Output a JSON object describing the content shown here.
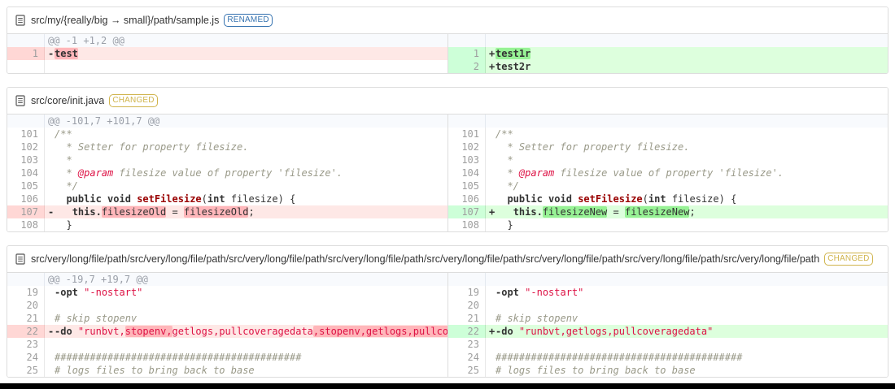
{
  "colors": {
    "panel_border": "#dddddd",
    "del_line_bg": "#fee8e6",
    "del_gutter_bg": "#ffd7d5",
    "del_word_highlight": "#ffb6ba",
    "ins_line_bg": "#ddffdd",
    "ins_gutter_bg": "#cdffd8",
    "ins_word_highlight": "#97f295",
    "hunk_header_bg": "#f8fafd",
    "renamed_tag": "#3572b0",
    "changed_tag": "#d0b44c",
    "string_token": "#d14",
    "comment_token": "#998",
    "function_token": "#900",
    "bottom_bar": "#000000"
  },
  "files": [
    {
      "name": "src/my/{really/big → small}/path/sample.js",
      "tag": "RENAMED",
      "tag_color": "#3572b0",
      "hunk_header": "@@ -1 +1,2 @@",
      "left": [
        {
          "type": "info",
          "text": "@@ -1 +1,2 @@"
        },
        {
          "type": "del",
          "num": "1",
          "prefix": "-",
          "segments": [
            {
              "t": "test",
              "c": "kw",
              "hl": true
            }
          ]
        },
        {
          "type": "empty"
        }
      ],
      "right": [
        {
          "type": "info",
          "text": ""
        },
        {
          "type": "ins",
          "num": "1",
          "prefix": "+",
          "segments": [
            {
              "t": "test1r",
              "c": "kw",
              "hl": true
            }
          ]
        },
        {
          "type": "ins",
          "num": "2",
          "prefix": "+",
          "segments": [
            {
              "t": "test2r",
              "c": "kw"
            }
          ]
        }
      ]
    },
    {
      "name": "src/core/init.java",
      "tag": "CHANGED",
      "tag_color": "#d0b44c",
      "hunk_header": "@@ -101,7 +101,7 @@",
      "left": [
        {
          "type": "info",
          "text": "@@ -101,7 +101,7 @@"
        },
        {
          "type": "cntx",
          "num": "101",
          "prefix": "",
          "segments": [
            {
              "t": "/**",
              "c": "com"
            }
          ]
        },
        {
          "type": "cntx",
          "num": "102",
          "prefix": "",
          "segments": [
            {
              "t": "  * Setter for property filesize.",
              "c": "com"
            }
          ]
        },
        {
          "type": "cntx",
          "num": "103",
          "prefix": "",
          "segments": [
            {
              "t": "  *",
              "c": "com"
            }
          ]
        },
        {
          "type": "cntx",
          "num": "104",
          "prefix": "",
          "segments": [
            {
              "t": "  * ",
              "c": "com"
            },
            {
              "t": "@param",
              "c": "doc"
            },
            {
              "t": " filesize value of property 'filesize'.",
              "c": "com"
            }
          ]
        },
        {
          "type": "cntx",
          "num": "105",
          "prefix": "",
          "segments": [
            {
              "t": "  */",
              "c": "com"
            }
          ]
        },
        {
          "type": "cntx",
          "num": "106",
          "prefix": "",
          "segments": [
            {
              "t": "  "
            },
            {
              "t": "public",
              "c": "kw"
            },
            {
              "t": " "
            },
            {
              "t": "void",
              "c": "kw"
            },
            {
              "t": " "
            },
            {
              "t": "setFilesize",
              "c": "title"
            },
            {
              "t": "("
            },
            {
              "t": "int",
              "c": "kw"
            },
            {
              "t": " filesize) {"
            }
          ]
        },
        {
          "type": "del",
          "num": "107",
          "prefix": "-",
          "segments": [
            {
              "t": "   "
            },
            {
              "t": "this.",
              "c": "kw"
            },
            {
              "t": "filesizeOld",
              "hl": true
            },
            {
              "t": " = "
            },
            {
              "t": "filesizeOld",
              "hl": true
            },
            {
              "t": ";"
            }
          ]
        },
        {
          "type": "cntx",
          "num": "108",
          "prefix": "",
          "segments": [
            {
              "t": "  }"
            }
          ]
        }
      ],
      "right": [
        {
          "type": "info",
          "text": ""
        },
        {
          "type": "cntx",
          "num": "101",
          "prefix": "",
          "segments": [
            {
              "t": "/**",
              "c": "com"
            }
          ]
        },
        {
          "type": "cntx",
          "num": "102",
          "prefix": "",
          "segments": [
            {
              "t": "  * Setter for property filesize.",
              "c": "com"
            }
          ]
        },
        {
          "type": "cntx",
          "num": "103",
          "prefix": "",
          "segments": [
            {
              "t": "  *",
              "c": "com"
            }
          ]
        },
        {
          "type": "cntx",
          "num": "104",
          "prefix": "",
          "segments": [
            {
              "t": "  * ",
              "c": "com"
            },
            {
              "t": "@param",
              "c": "doc"
            },
            {
              "t": " filesize value of property 'filesize'.",
              "c": "com"
            }
          ]
        },
        {
          "type": "cntx",
          "num": "105",
          "prefix": "",
          "segments": [
            {
              "t": "  */",
              "c": "com"
            }
          ]
        },
        {
          "type": "cntx",
          "num": "106",
          "prefix": "",
          "segments": [
            {
              "t": "  "
            },
            {
              "t": "public",
              "c": "kw"
            },
            {
              "t": " "
            },
            {
              "t": "void",
              "c": "kw"
            },
            {
              "t": " "
            },
            {
              "t": "setFilesize",
              "c": "title"
            },
            {
              "t": "("
            },
            {
              "t": "int",
              "c": "kw"
            },
            {
              "t": " filesize) {"
            }
          ]
        },
        {
          "type": "ins",
          "num": "107",
          "prefix": "+",
          "segments": [
            {
              "t": "   "
            },
            {
              "t": "this.",
              "c": "kw"
            },
            {
              "t": "filesizeNew",
              "hl": true
            },
            {
              "t": " = "
            },
            {
              "t": "filesizeNew",
              "hl": true
            },
            {
              "t": ";"
            }
          ]
        },
        {
          "type": "cntx",
          "num": "108",
          "prefix": "",
          "segments": [
            {
              "t": "  }"
            }
          ]
        }
      ]
    },
    {
      "name": "src/very/long/file/path/src/very/long/file/path/src/very/long/file/path/src/very/long/file/path/src/very/long/file/path/src/very/long/file/path/src/very/long/file/path/src/very/long/file/path",
      "tag": "CHANGED",
      "tag_color": "#d0b44c",
      "hunk_header": "@@ -19,7 +19,7 @@",
      "left": [
        {
          "type": "info",
          "text": "@@ -19,7 +19,7 @@"
        },
        {
          "type": "cntx",
          "num": "19",
          "prefix": "",
          "segments": [
            {
              "t": "-opt",
              "c": "kw"
            },
            {
              "t": " "
            },
            {
              "t": "\"-nostart\"",
              "c": "str"
            }
          ]
        },
        {
          "type": "cntx",
          "num": "20",
          "prefix": "",
          "segments": []
        },
        {
          "type": "cntx",
          "num": "21",
          "prefix": "",
          "segments": [
            {
              "t": "# skip stopenv",
              "c": "com"
            }
          ]
        },
        {
          "type": "del",
          "num": "22",
          "prefix": "-",
          "segments": [
            {
              "t": "-do",
              "c": "kw"
            },
            {
              "t": " "
            },
            {
              "t": "\"runbvt,",
              "c": "str"
            },
            {
              "t": "stopenv,",
              "c": "str",
              "hl": true
            },
            {
              "t": "getlogs,pullcoveragedata",
              "c": "str"
            },
            {
              "t": ",stopenv,getlogs,pullcoveragedata",
              "c": "str",
              "hl": true
            },
            {
              "t": "\"",
              "c": "str"
            }
          ]
        },
        {
          "type": "cntx",
          "num": "23",
          "prefix": "",
          "segments": []
        },
        {
          "type": "cntx",
          "num": "24",
          "prefix": "",
          "segments": [
            {
              "t": "##########################################",
              "c": "com"
            }
          ]
        },
        {
          "type": "cntx",
          "num": "25",
          "prefix": "",
          "segments": [
            {
              "t": "# logs files to bring back to base",
              "c": "com"
            }
          ]
        }
      ],
      "right": [
        {
          "type": "info",
          "text": ""
        },
        {
          "type": "cntx",
          "num": "19",
          "prefix": "",
          "segments": [
            {
              "t": "-opt",
              "c": "kw"
            },
            {
              "t": " "
            },
            {
              "t": "\"-nostart\"",
              "c": "str"
            }
          ]
        },
        {
          "type": "cntx",
          "num": "20",
          "prefix": "",
          "segments": []
        },
        {
          "type": "cntx",
          "num": "21",
          "prefix": "",
          "segments": [
            {
              "t": "# skip stopenv",
              "c": "com"
            }
          ]
        },
        {
          "type": "ins",
          "num": "22",
          "prefix": "+",
          "segments": [
            {
              "t": "-do",
              "c": "kw"
            },
            {
              "t": " "
            },
            {
              "t": "\"runbvt,getlogs,pullcoveragedata\"",
              "c": "str"
            }
          ]
        },
        {
          "type": "cntx",
          "num": "23",
          "prefix": "",
          "segments": []
        },
        {
          "type": "cntx",
          "num": "24",
          "prefix": "",
          "segments": [
            {
              "t": "##########################################",
              "c": "com"
            }
          ]
        },
        {
          "type": "cntx",
          "num": "25",
          "prefix": "",
          "segments": [
            {
              "t": "# logs files to bring back to base",
              "c": "com"
            }
          ]
        }
      ]
    }
  ]
}
